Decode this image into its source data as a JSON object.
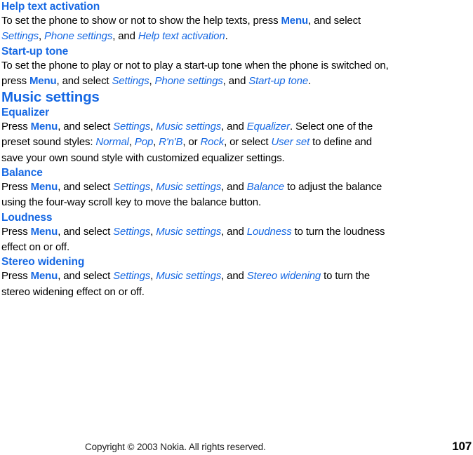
{
  "document": {
    "type": "user-guide-page",
    "page_number": "107",
    "heading_color": "#1668e3",
    "body_color": "#000000"
  },
  "sections": [
    {
      "id": "help-text-activation",
      "level": "h2",
      "title": "Help text activation",
      "paragraph": {
        "runs": [
          {
            "text": "To set the phone to show or not to show the help texts, press ",
            "style": "plain"
          },
          {
            "text": "Menu",
            "style": "keyword"
          },
          {
            "text": ", and select ",
            "style": "plain"
          },
          {
            "text": "Settings",
            "style": "menu-item"
          },
          {
            "text": ", ",
            "style": "plain"
          },
          {
            "text": "Phone settings",
            "style": "menu-item"
          },
          {
            "text": ", and ",
            "style": "plain"
          },
          {
            "text": "Help text activation",
            "style": "menu-item"
          },
          {
            "text": ".",
            "style": "plain"
          }
        ]
      }
    },
    {
      "id": "start-up-tone",
      "level": "h2",
      "title": "Start-up tone",
      "paragraph": {
        "runs": [
          {
            "text": "To set the phone to play or not to play a start-up tone when the phone is switched on, press ",
            "style": "plain"
          },
          {
            "text": "Menu",
            "style": "keyword"
          },
          {
            "text": ", and select ",
            "style": "plain"
          },
          {
            "text": "Settings",
            "style": "menu-item"
          },
          {
            "text": ", ",
            "style": "plain"
          },
          {
            "text": "Phone settings",
            "style": "menu-item"
          },
          {
            "text": ", and ",
            "style": "plain"
          },
          {
            "text": "Start-up tone",
            "style": "menu-item"
          },
          {
            "text": ".",
            "style": "plain"
          }
        ]
      }
    },
    {
      "id": "music-settings",
      "level": "h1",
      "title": "Music settings"
    },
    {
      "id": "equalizer",
      "level": "h2",
      "title": "Equalizer",
      "paragraph": {
        "runs": [
          {
            "text": "Press ",
            "style": "plain"
          },
          {
            "text": "Menu",
            "style": "keyword"
          },
          {
            "text": ", and select ",
            "style": "plain"
          },
          {
            "text": "Settings",
            "style": "menu-item"
          },
          {
            "text": ", ",
            "style": "plain"
          },
          {
            "text": "Music settings",
            "style": "menu-item"
          },
          {
            "text": ", and ",
            "style": "plain"
          },
          {
            "text": "Equalizer",
            "style": "menu-item"
          },
          {
            "text": ". Select one of the preset sound styles: ",
            "style": "plain"
          },
          {
            "text": "Normal",
            "style": "menu-item"
          },
          {
            "text": ", ",
            "style": "plain"
          },
          {
            "text": "Pop",
            "style": "menu-item"
          },
          {
            "text": ", ",
            "style": "plain"
          },
          {
            "text": "R'n'B",
            "style": "menu-item"
          },
          {
            "text": ", or ",
            "style": "plain"
          },
          {
            "text": "Rock",
            "style": "menu-item"
          },
          {
            "text": ", or select ",
            "style": "plain"
          },
          {
            "text": "User set",
            "style": "menu-item"
          },
          {
            "text": " to define and save your own sound style with customized equalizer settings.",
            "style": "plain"
          }
        ]
      }
    },
    {
      "id": "balance",
      "level": "h2",
      "title": "Balance",
      "paragraph": {
        "runs": [
          {
            "text": "Press ",
            "style": "plain"
          },
          {
            "text": "Menu",
            "style": "keyword"
          },
          {
            "text": ", and select ",
            "style": "plain"
          },
          {
            "text": "Settings",
            "style": "menu-item"
          },
          {
            "text": ", ",
            "style": "plain"
          },
          {
            "text": "Music settings",
            "style": "menu-item"
          },
          {
            "text": ", and ",
            "style": "plain"
          },
          {
            "text": "Balance",
            "style": "menu-item"
          },
          {
            "text": " to adjust the balance using the four-way scroll key to move the balance button.",
            "style": "plain"
          }
        ]
      }
    },
    {
      "id": "loudness",
      "level": "h2",
      "title": "Loudness",
      "paragraph": {
        "runs": [
          {
            "text": "Press ",
            "style": "plain"
          },
          {
            "text": "Menu",
            "style": "keyword"
          },
          {
            "text": ", and select ",
            "style": "plain"
          },
          {
            "text": "Settings",
            "style": "menu-item"
          },
          {
            "text": ", ",
            "style": "plain"
          },
          {
            "text": "Music settings",
            "style": "menu-item"
          },
          {
            "text": ", and ",
            "style": "plain"
          },
          {
            "text": "Loudness",
            "style": "menu-item"
          },
          {
            "text": " to turn the loudness effect on or off.",
            "style": "plain"
          }
        ]
      }
    },
    {
      "id": "stereo-widening",
      "level": "h2",
      "title": "Stereo widening",
      "paragraph": {
        "runs": [
          {
            "text": "Press ",
            "style": "plain"
          },
          {
            "text": "Menu",
            "style": "keyword"
          },
          {
            "text": ", and select ",
            "style": "plain"
          },
          {
            "text": "Settings",
            "style": "menu-item"
          },
          {
            "text": ", ",
            "style": "plain"
          },
          {
            "text": "Music settings",
            "style": "menu-item"
          },
          {
            "text": ", and ",
            "style": "plain"
          },
          {
            "text": "Stereo widening",
            "style": "menu-item"
          },
          {
            "text": " to turn the stereo widening effect on or off.",
            "style": "plain"
          }
        ]
      }
    }
  ],
  "footer": {
    "copyright": "Copyright © 2003 Nokia. All rights reserved.",
    "page_number": "107"
  }
}
